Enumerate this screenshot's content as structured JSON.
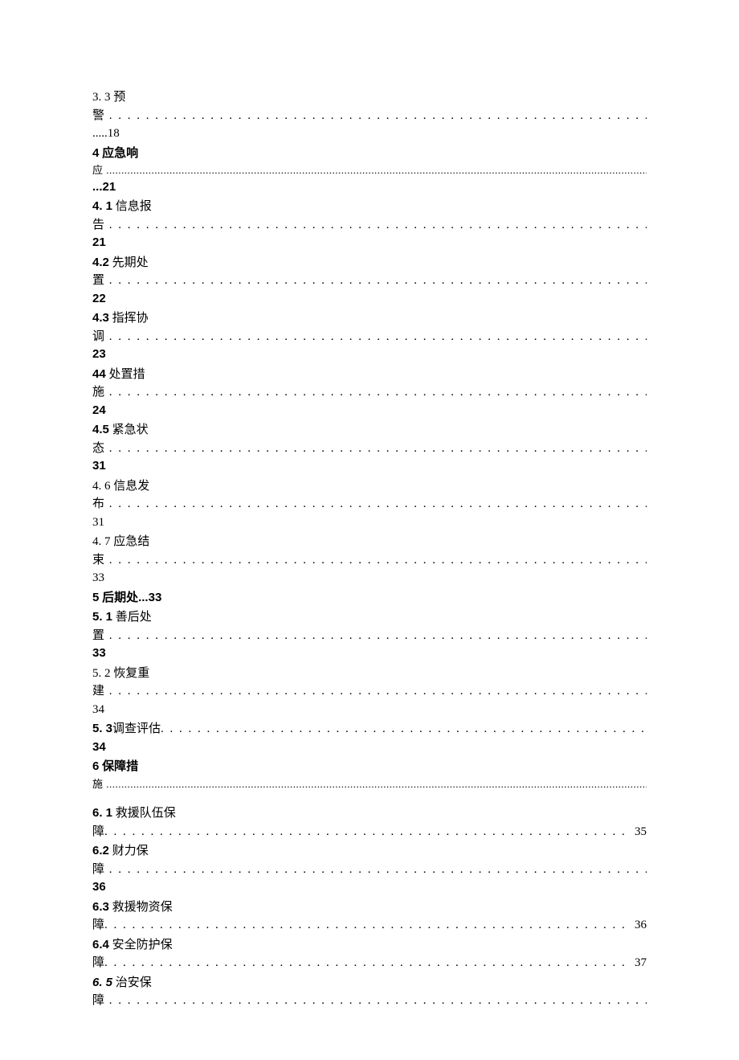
{
  "toc": [
    {
      "style": "plain",
      "num": "3.   3",
      "title": "预警",
      "dots": "spaced",
      "page": ".....18",
      "pageInline": false
    },
    {
      "style": "bold",
      "num": "4",
      "title": "应急响应",
      "dots": "fine",
      "page": "...21",
      "pageInline": false
    },
    {
      "style": "boldnum",
      "num": "4.   1",
      "title": "信息报告",
      "dots": "spaced",
      "page": "21",
      "pageInline": false
    },
    {
      "style": "boldnum",
      "num": "4.2",
      "title": "先期处置",
      "dots": "spaced",
      "page": "22",
      "pageInline": false
    },
    {
      "style": "boldnum",
      "num": "4.3",
      "title": "指挥协调",
      "dots": "spaced",
      "page": "23",
      "pageInline": false
    },
    {
      "style": "boldnum",
      "num": "44",
      "title": "处置措施",
      "dots": "spaced",
      "page": "24",
      "pageInline": false
    },
    {
      "style": "boldnum",
      "num": "4.5",
      "title": "紧急状态",
      "dots": "spaced",
      "page": "31",
      "pageInline": false
    },
    {
      "style": "plain",
      "num": "4.   6",
      "title": "信息发布",
      "dots": "spaced",
      "page": "31",
      "pageInline": false
    },
    {
      "style": "plain",
      "num": "4.   7",
      "title": "应急结束",
      "dots": "spaced",
      "page": "33",
      "pageInline": false
    },
    {
      "style": "boldshort",
      "num": "5",
      "title": "后期处...33",
      "dots": "none",
      "page": "",
      "pageInline": true
    },
    {
      "style": "boldnum",
      "num": "5.   1",
      "title": "善后处置",
      "dots": "spaced",
      "page": "33",
      "pageInline": false
    },
    {
      "style": "plain",
      "num": "5.   2",
      "title": "恢复重建",
      "dots": "spaced",
      "page": "34",
      "pageInline": false
    },
    {
      "style": "boldnum",
      "num": "5.   3",
      "title": "调查评估",
      "dots": "spacedshort",
      "page": "34",
      "pageInline": false
    },
    {
      "style": "bold",
      "num": "6",
      "title": "保障措施",
      "dots": "fine",
      "page": "",
      "pageInline": false,
      "extraBlank": true
    },
    {
      "style": "boldnum",
      "num": "6.   1",
      "title": "救援队伍保障",
      "dots": "spacedinline",
      "page": "35",
      "pageInline": true
    },
    {
      "style": "boldnum",
      "num": "6.2",
      "title": "财力保障",
      "dots": "spaced",
      "page": "36",
      "pageInline": false
    },
    {
      "style": "boldnum",
      "num": "6.3",
      "title": "救援物资保障",
      "dots": "spacedinline",
      "page": "36",
      "pageInline": true
    },
    {
      "style": "boldnum",
      "num": "6.4",
      "title": "安全防护保障",
      "dots": "spacedinline",
      "page": "37",
      "pageInline": true
    },
    {
      "style": "italic",
      "num": "6.   5",
      "title": "治安保障",
      "dots": "spaced",
      "page": "",
      "pageInline": false
    }
  ]
}
